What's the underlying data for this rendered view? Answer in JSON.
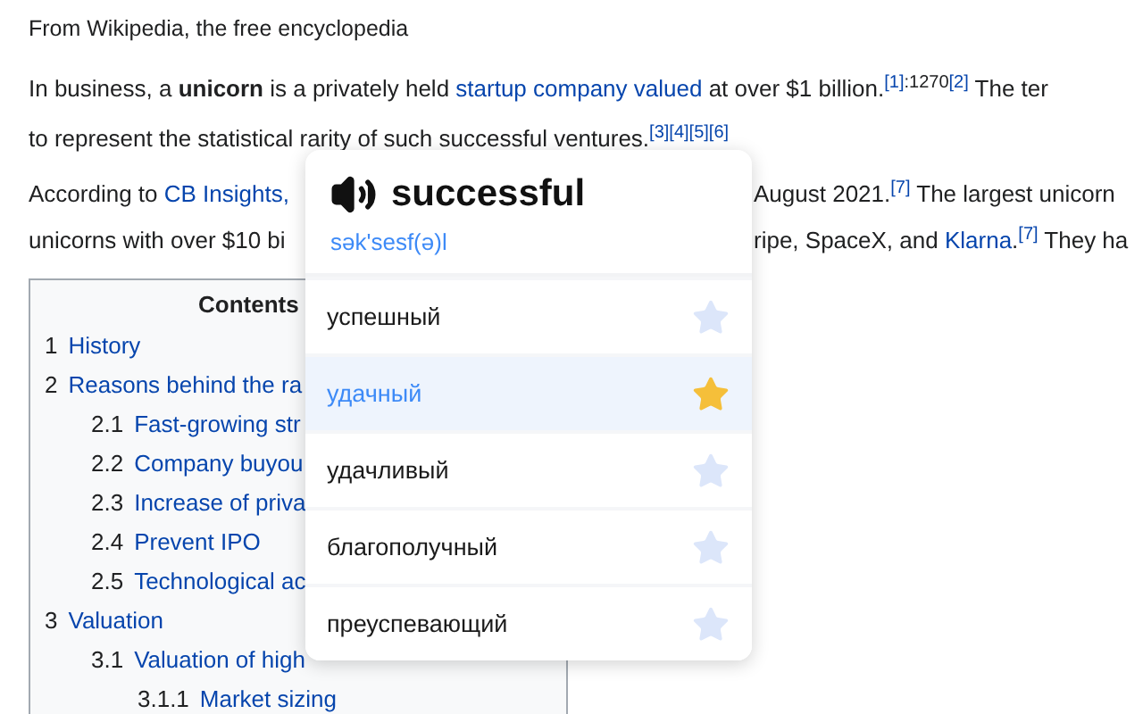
{
  "article": {
    "tagline": "From Wikipedia, the free encyclopedia",
    "paragraphs": [
      [
        {
          "kind": "text",
          "text": "In business, a "
        },
        {
          "kind": "bold",
          "text": "unicorn"
        },
        {
          "kind": "text",
          "text": " is a privately held "
        },
        {
          "kind": "link",
          "text": "startup company valued"
        },
        {
          "kind": "text",
          "text": " at over $1 billion."
        },
        {
          "kind": "ref",
          "text": "[1]"
        },
        {
          "kind": "page",
          "text": ":1270"
        },
        {
          "kind": "ref",
          "text": "[2]"
        },
        {
          "kind": "text",
          "text": " The ter"
        }
      ],
      [
        {
          "kind": "text",
          "text": "to represent the statistical rarity of such successful ventures."
        },
        {
          "kind": "ref",
          "text": "[3]"
        },
        {
          "kind": "ref",
          "text": "[4]"
        },
        {
          "kind": "ref",
          "text": "[5]"
        },
        {
          "kind": "ref",
          "text": "[6]"
        }
      ]
    ],
    "cut_lines": [
      {
        "left": [
          {
            "kind": "text",
            "text": "According to "
          },
          {
            "kind": "link",
            "text": "CB Insights,"
          }
        ],
        "right": [
          {
            "kind": "text",
            "text": "August 2021."
          },
          {
            "kind": "ref",
            "text": "[7]"
          },
          {
            "kind": "text",
            "text": " The largest unicorn"
          }
        ]
      },
      {
        "left": [
          {
            "kind": "text",
            "text": "unicorns with over $10 bi"
          }
        ],
        "right": [
          {
            "kind": "text",
            "text": "ripe, SpaceX, and "
          },
          {
            "kind": "link",
            "text": "Klarna",
            "suffix": "."
          },
          {
            "kind": "ref",
            "text": "[7]"
          },
          {
            "kind": "text",
            "text": " They ha"
          }
        ]
      }
    ]
  },
  "contents": {
    "title": "Contents",
    "items": [
      {
        "number": "1",
        "label": "History"
      },
      {
        "number": "2",
        "label": "Reasons behind the ra",
        "children": [
          {
            "number": "2.1",
            "label": "Fast-growing str"
          },
          {
            "number": "2.2",
            "label": "Company buyou"
          },
          {
            "number": "2.3",
            "label": "Increase of priva"
          },
          {
            "number": "2.4",
            "label": "Prevent IPO"
          },
          {
            "number": "2.5",
            "label": "Technological ac"
          }
        ]
      },
      {
        "number": "3",
        "label": "Valuation",
        "children": [
          {
            "number": "3.1",
            "label": "Valuation of high",
            "children": [
              {
                "number": "3.1.1",
                "label": "Market sizing"
              }
            ]
          }
        ]
      }
    ]
  },
  "popup": {
    "word": "successful",
    "transcription": "sək'sesf(ə)l",
    "translations": [
      {
        "text": "успешный",
        "selected": false,
        "starred": false
      },
      {
        "text": "удачный",
        "selected": true,
        "starred": true
      },
      {
        "text": "удачливый",
        "selected": false,
        "starred": false
      },
      {
        "text": "благополучный",
        "selected": false,
        "starred": false
      },
      {
        "text": "преуспевающий",
        "selected": false,
        "starred": false
      }
    ]
  }
}
